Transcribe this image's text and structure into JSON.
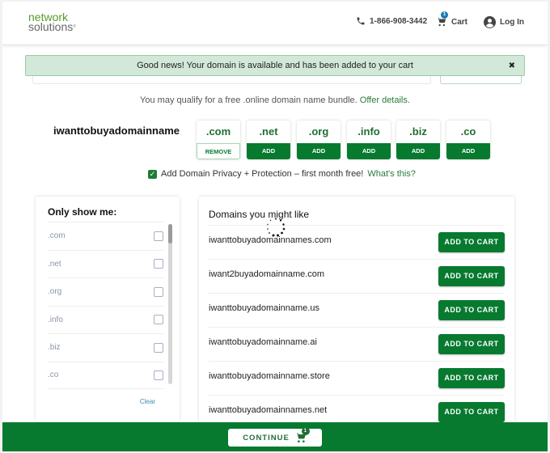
{
  "header": {
    "logo_line1": "network",
    "logo_line2": "solutions",
    "logo_reg": "®",
    "phone": "1-866-908-3442",
    "cart_label": "Cart",
    "cart_count": "1",
    "login_label": "Log In"
  },
  "alert": {
    "message": "Good news! Your domain is available and has been added to your cart",
    "close_icon": "✖"
  },
  "offer": {
    "text": "You may qualify for a free .online domain name bundle.",
    "link": "Offer details",
    "suffix": "."
  },
  "domain": {
    "name": "iwanttobuyadomainname",
    "tlds": [
      {
        "tld": ".com",
        "action": "REMOVE"
      },
      {
        "tld": ".net",
        "action": "ADD"
      },
      {
        "tld": ".org",
        "action": "ADD"
      },
      {
        "tld": ".info",
        "action": "ADD"
      },
      {
        "tld": ".biz",
        "action": "ADD"
      },
      {
        "tld": ".co",
        "action": "ADD"
      }
    ]
  },
  "privacy": {
    "checked": true,
    "check_glyph": "✓",
    "text": "Add Domain Privacy + Protection – first month free!",
    "link": "What's this?"
  },
  "filter": {
    "title": "Only show me:",
    "items": [
      ".com",
      ".net",
      ".org",
      ".info",
      ".biz",
      ".co"
    ],
    "clear_label": "Clear"
  },
  "suggestions": {
    "title": "Domains you might like",
    "button_label": "ADD TO CART",
    "items": [
      "iwanttobuyadomainnames.com",
      "iwant2buyadomainname.com",
      "iwanttobuyadomainname.us",
      "iwanttobuyadomainname.ai",
      "iwanttobuyadomainname.store",
      "iwanttobuyadomainnames.net"
    ]
  },
  "footer": {
    "continue_label": "CONTINUE",
    "cart_count": "1"
  },
  "colors": {
    "brand_green": "#077a30",
    "alert_bg": "#d2e8d8",
    "badge_blue": "#1a7ab8"
  }
}
